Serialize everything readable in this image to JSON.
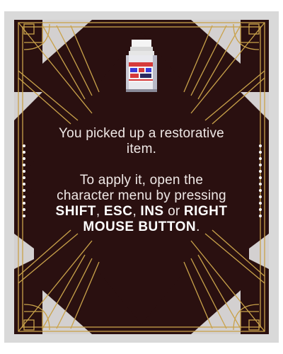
{
  "popup": {
    "item": "restorative item",
    "item_icon": "pill-bottle-icon",
    "line1": "You picked up a restorative",
    "line2": "item.",
    "line3": "To apply it, open the",
    "line4": "character menu by pressing",
    "key1": "SHIFT",
    "sep1": ", ",
    "key2": "ESC",
    "sep2": ", ",
    "key3": "INS",
    "sep3": " or ",
    "key4a": "RIGHT",
    "key4b": "MOUSE BUTTON",
    "end": "."
  },
  "colors": {
    "panel": "#2a1010",
    "gold": "#c9a24a",
    "corner_white": "#dcdcdc",
    "text": "#efe8e6"
  }
}
